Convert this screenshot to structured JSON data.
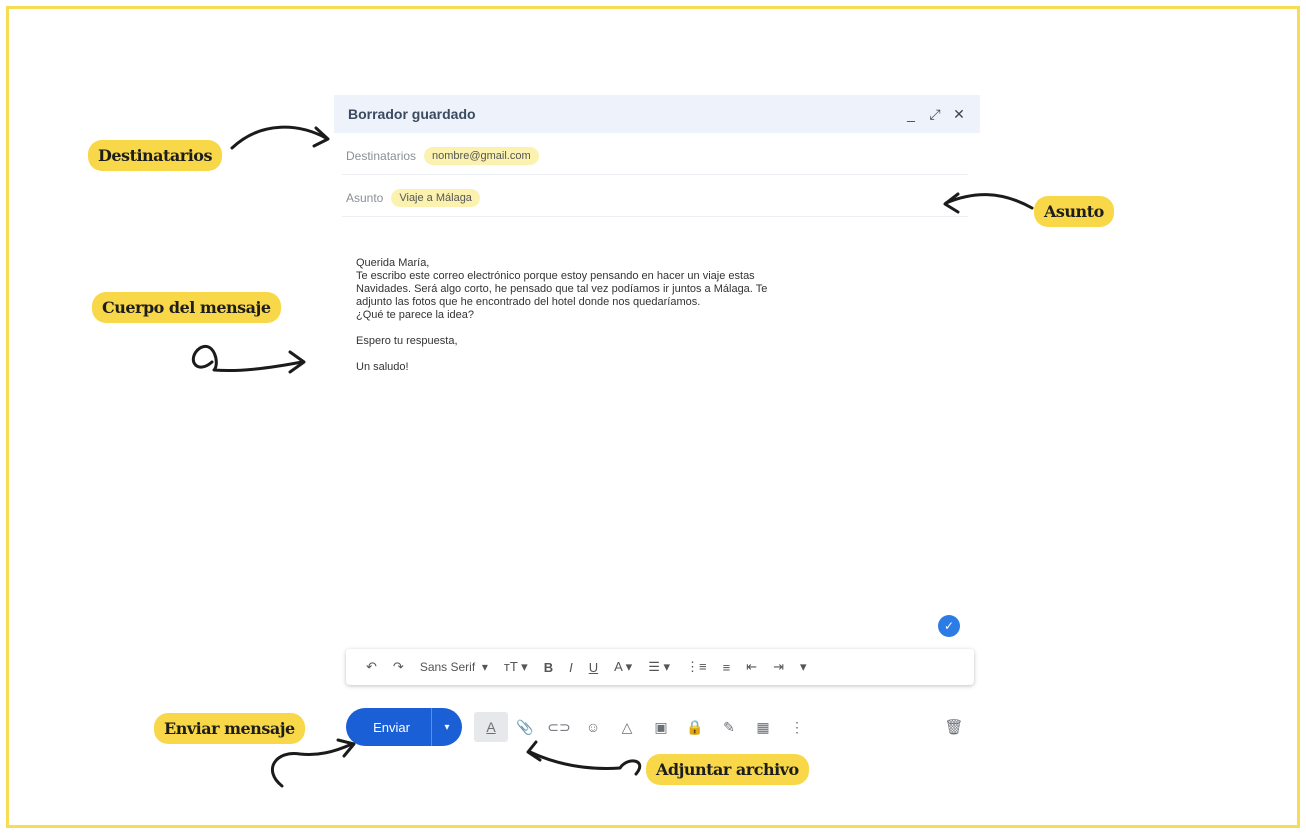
{
  "compose": {
    "title": "Borrador guardado",
    "controls": {
      "minimize": "_",
      "expand": "⤢",
      "close": "✕"
    },
    "to_label": "Destinatarios",
    "to_value": "nombre@gmail.com",
    "subject_label": "Asunto",
    "subject_value": "Viaje a Málaga",
    "body": {
      "greeting": "Querida María,",
      "para_lines": [
        "Te escribo este correo electrónico porque estoy pensando en hacer un viaje estas",
        "Navidades. Será algo corto, he pensado que tal vez podíamos ir juntos a Málaga. Te",
        "adjunto las fotos que he encontrado del hotel donde nos quedaríamos.",
        "¿Qué te parece la idea?"
      ],
      "closing1": "Espero tu respuesta,",
      "closing2": "Un saludo!"
    },
    "format_bar": {
      "undo": "↶",
      "redo": "↷",
      "font": "Sans Serif",
      "font_caret": "▾",
      "size": "тT ▾",
      "bold": "B",
      "italic": "I",
      "underline": "U",
      "text_color": "A ▾",
      "align": "☰ ▾",
      "numbered": "⋮≡",
      "bulleted": "≡",
      "indent_less": "⇤",
      "indent_more": "⇥",
      "more": "▾"
    },
    "send_label": "Enviar",
    "send_caret": "▾",
    "tools": {
      "format": "A",
      "attach": "📎",
      "link": "⊂⊃",
      "emoji": "☺",
      "drive": "△",
      "photo": "▣",
      "lock": "🔒",
      "signature": "✎",
      "calendar": "▦",
      "more": "⋮"
    },
    "trash": "🗑"
  },
  "annotations": {
    "destinatarios": "Destinatarios",
    "asunto": "Asunto",
    "cuerpo": "Cuerpo del mensaje",
    "enviar": "Enviar mensaje",
    "adjuntar": "Adjuntar archivo"
  },
  "colors": {
    "highlight": "#f8d848",
    "send_button": "#1a5fd6",
    "title_bar": "#edf2fb",
    "frame": "#f7dc55"
  }
}
